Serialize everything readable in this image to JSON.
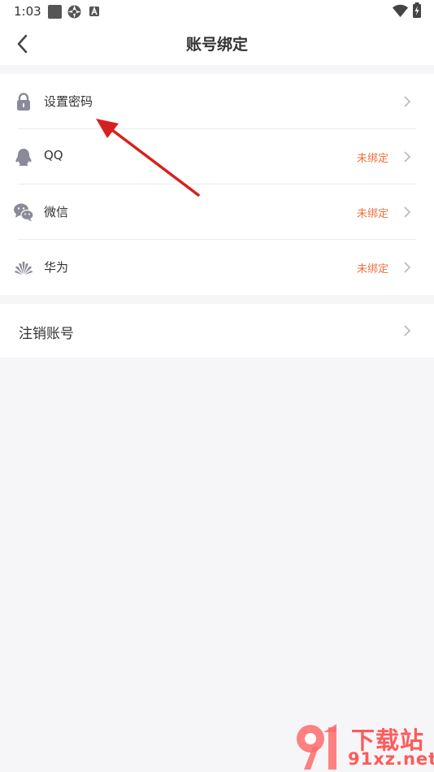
{
  "status_bar": {
    "time": "1:03"
  },
  "header": {
    "title": "账号绑定"
  },
  "bindings": [
    {
      "label": "设置密码",
      "status": "",
      "icon": "lock-icon"
    },
    {
      "label": "QQ",
      "status": "未绑定",
      "icon": "qq-icon"
    },
    {
      "label": "微信",
      "status": "未绑定",
      "icon": "wechat-icon"
    },
    {
      "label": "华为",
      "status": "未绑定",
      "icon": "huawei-icon"
    }
  ],
  "cancel_account": {
    "label": "注销账号"
  },
  "watermark": {
    "logo_text": "91",
    "line1": "下载站",
    "line2": "91xz.net"
  },
  "colors": {
    "status_unbound": "#f0703e",
    "annotation_arrow": "#d81f1f",
    "icon_gray": "#8a8a9a"
  }
}
